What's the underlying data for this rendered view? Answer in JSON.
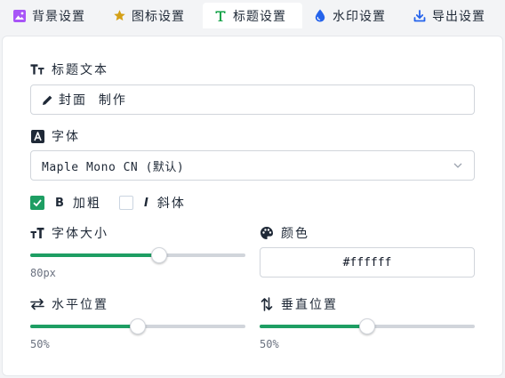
{
  "tabs": [
    {
      "label": "背景设置",
      "icon": "image-icon",
      "color": "#a855f7"
    },
    {
      "label": "图标设置",
      "icon": "star-icon",
      "color": "#d4a017"
    },
    {
      "label": "标题设置",
      "icon": "text-t-icon",
      "color": "#16a34a"
    },
    {
      "label": "水印设置",
      "icon": "droplet-icon",
      "color": "#2563eb"
    },
    {
      "label": "导出设置",
      "icon": "download-icon",
      "color": "#2563eb"
    }
  ],
  "active_tab": "标题设置",
  "title_text": {
    "label": "标题文本",
    "value": "封面  制作",
    "icon": "pencil-icon"
  },
  "font": {
    "label": "字体",
    "selected": "Maple Mono CN (默认)"
  },
  "style": {
    "bold_label": "加粗",
    "bold_checked": true,
    "italic_label": "斜体",
    "italic_checked": false
  },
  "font_size": {
    "label": "字体大小",
    "value_text": "80px",
    "fraction": 0.6
  },
  "color": {
    "label": "颜色",
    "value": "#ffffff"
  },
  "h_position": {
    "label": "水平位置",
    "value_text": "50%",
    "fraction": 0.5
  },
  "v_position": {
    "label": "垂直位置",
    "value_text": "50%",
    "fraction": 0.5
  },
  "accent_color": "#1e9e63"
}
